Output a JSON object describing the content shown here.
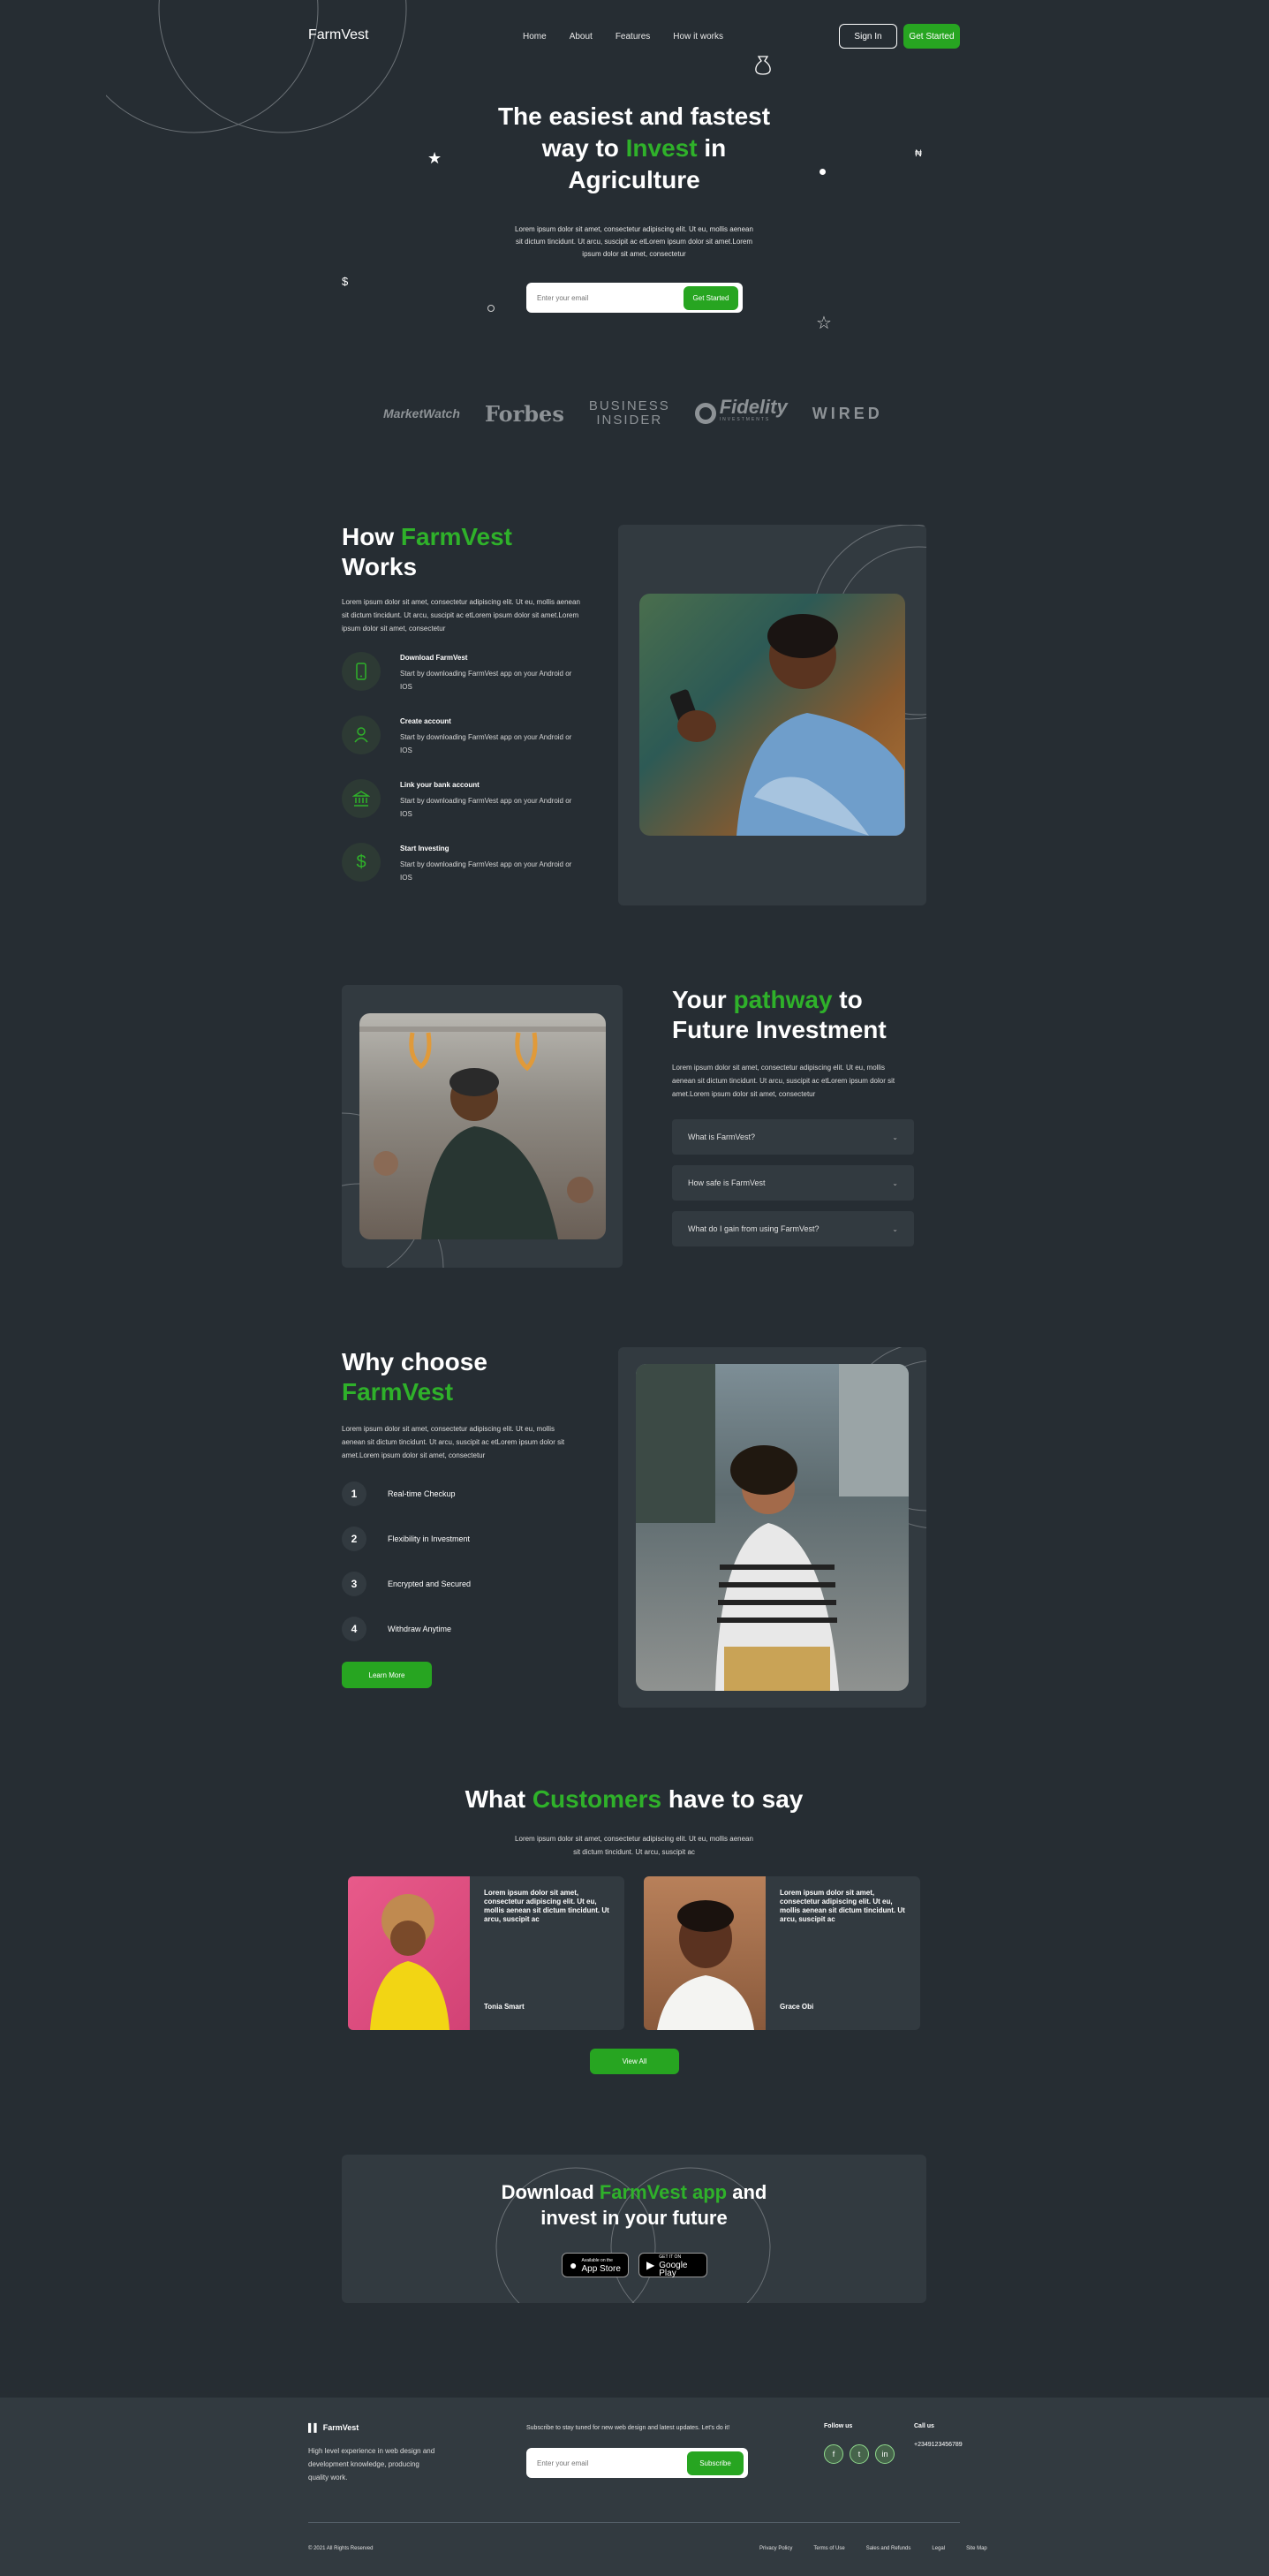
{
  "nav": {
    "logo": "FarmVest",
    "links": [
      "Home",
      "About",
      "Features",
      "How it works"
    ],
    "sign_in": "Sign In",
    "get_started": "Get Started"
  },
  "hero": {
    "title_line1": "The easiest and fastest",
    "title_pre": "way to ",
    "title_accent": "Invest",
    "title_post": " in",
    "title_line3": "Agriculture",
    "subtitle": "Lorem ipsum dolor sit amet, consectetur adipiscing elit. Ut eu, mollis aenean sit dictum tincidunt. Ut arcu, suscipit ac etLorem ipsum dolor sit amet.Lorem ipsum dolor sit amet, consectetur",
    "email_placeholder": "Enter your email",
    "cta": "Get Started",
    "symbols": [
      "$",
      "₦",
      "★",
      "☆"
    ]
  },
  "press_logos": [
    "MarketWatch",
    "Forbes",
    "BUSINESS",
    "INSIDER",
    "Fidelity",
    "INVESTMENTS",
    "WIRED"
  ],
  "how_it_works": {
    "title_pre": "How ",
    "title_accent": "FarmVest",
    "title_line2": "Works",
    "body": "Lorem ipsum dolor sit amet, consectetur adipiscing elit. Ut eu, mollis aenean sit dictum tincidunt. Ut arcu, suscipit ac etLorem ipsum dolor sit amet.Lorem ipsum dolor sit amet, consectetur",
    "steps": [
      {
        "title": "Download FarmVest",
        "desc": "Start by downloading FarmVest app on your Android or IOS",
        "icon": "phone-icon"
      },
      {
        "title": "Create account",
        "desc": "Start by downloading FarmVest app on your Android or IOS",
        "icon": "user-icon"
      },
      {
        "title": "Link your bank account",
        "desc": "Start by downloading FarmVest app on your Android or IOS",
        "icon": "bank-icon"
      },
      {
        "title": "Start Investing",
        "desc": "Start by downloading FarmVest app on your Android or IOS",
        "icon": "dollar-icon"
      }
    ]
  },
  "pathway": {
    "title_pre": "Your ",
    "title_accent": "pathway",
    "title_post": " to",
    "title_line2": "Future Investment",
    "body": "Lorem ipsum dolor sit amet, consectetur adipiscing elit. Ut eu, mollis aenean sit dictum tincidunt. Ut arcu, suscipit ac etLorem ipsum dolor sit amet.Lorem ipsum dolor sit amet, consectetur",
    "faqs": [
      "What is FarmVest?",
      "How safe is FarmVest",
      "What do I gain from using FarmVest?"
    ]
  },
  "why": {
    "title_line1": "Why choose",
    "title_accent": "FarmVest",
    "body": "Lorem ipsum dolor sit amet, consectetur adipiscing elit. Ut eu, mollis aenean sit dictum tincidunt. Ut arcu, suscipit ac etLorem ipsum dolor sit amet.Lorem ipsum dolor sit amet, consectetur",
    "reasons": [
      {
        "num": "1",
        "label": "Real-time Checkup"
      },
      {
        "num": "2",
        "label": "Flexibility in Investment"
      },
      {
        "num": "3",
        "label": "Encrypted and Secured"
      },
      {
        "num": "4",
        "label": "Withdraw Anytime"
      }
    ],
    "cta": "Learn More"
  },
  "testimonials": {
    "title_pre": "What ",
    "title_accent": "Customers",
    "title_post": " have to say",
    "subtitle": "Lorem ipsum dolor sit amet, consectetur adipiscing elit. Ut eu, mollis aenean sit dictum tincidunt. Ut arcu, suscipit ac",
    "items": [
      {
        "text": "Lorem ipsum dolor sit amet, consectetur adipiscing elit. Ut eu, mollis aenean sit dictum tincidunt. Ut arcu, suscipit ac",
        "name": "Tonia Smart"
      },
      {
        "text": "Lorem ipsum dolor sit amet, consectetur adipiscing elit. Ut eu, mollis aenean sit dictum tincidunt. Ut arcu, suscipit ac",
        "name": "Grace Obi"
      }
    ],
    "view_all": "View All"
  },
  "download": {
    "title_pre": "Download ",
    "title_accent": "FarmVest app",
    "title_post": " and",
    "title_line2": "invest in your future",
    "app_store_small": "Available on the",
    "app_store": "App Store",
    "google_small": "GET IT ON",
    "google": "Google Play"
  },
  "footer": {
    "logo": "FarmVest",
    "about": "High level experience in web design and development knowledge, producing quality work.",
    "subscribe_text": "Subscribe to stay tuned for new web design and latest updates. Let's do it!",
    "email_placeholder": "Enter your email",
    "subscribe_btn": "Subscribe",
    "follow": "Follow us",
    "social": [
      "f",
      "t",
      "in"
    ],
    "call": "Call us",
    "phone": "+2349123456789",
    "copyright": "© 2021 All Rights Reserved",
    "links": [
      "Privacy Policy",
      "Terms of Use",
      "Sales and Refunds",
      "Legal",
      "Site Map"
    ]
  },
  "colors": {
    "background": "#262d33",
    "panel": "#323a40",
    "accent": "#2fb12a"
  }
}
